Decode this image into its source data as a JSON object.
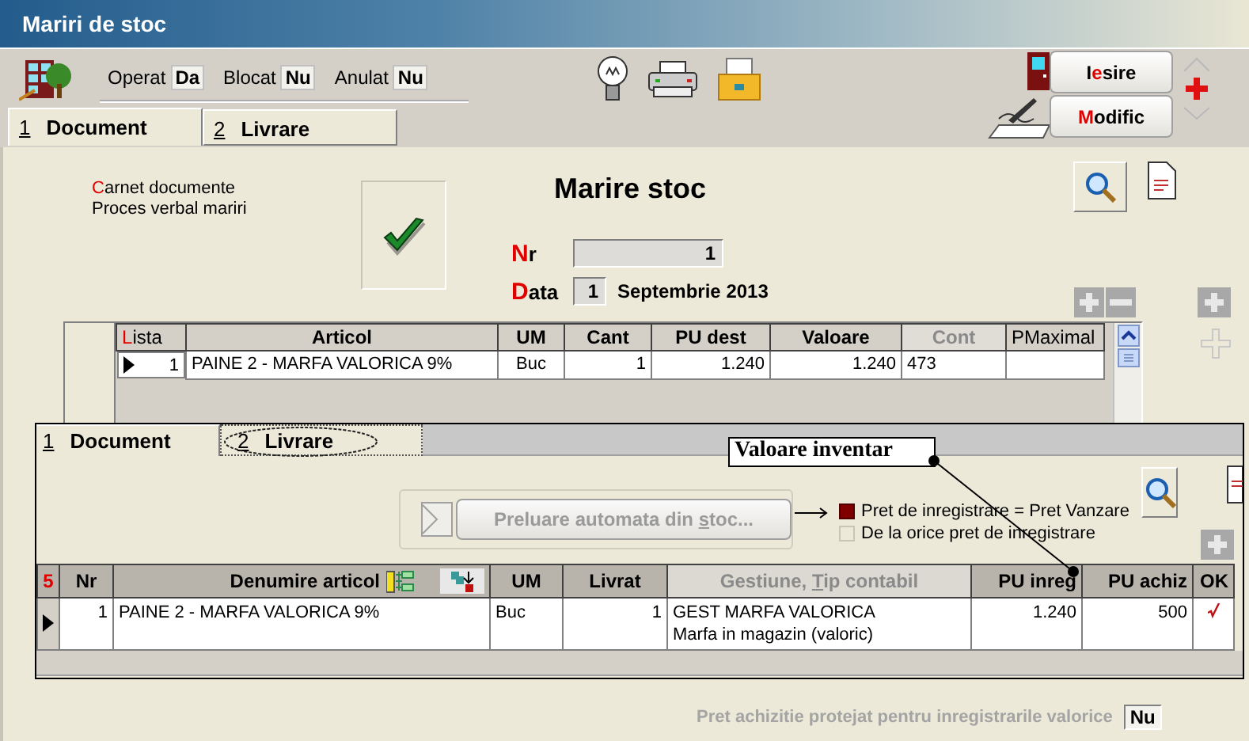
{
  "window": {
    "title": "Mariri de stoc"
  },
  "status_flags": [
    {
      "label": "Operat",
      "value": "Da"
    },
    {
      "label": "Blocat",
      "value": "Nu"
    },
    {
      "label": "Anulat",
      "value": "Nu"
    }
  ],
  "actions": [
    {
      "before": "I",
      "hotkey": "e",
      "after": "sire"
    },
    {
      "hotkey": "M",
      "after": "odific"
    }
  ],
  "tabs": [
    {
      "number": "1",
      "label": "Document",
      "selected": true
    },
    {
      "number": "2",
      "label": "Livrare",
      "selected": false
    }
  ],
  "document": {
    "book_lines": [
      {
        "hotkey": "C",
        "after": "arnet documente"
      },
      {
        "before": "Proces verbal mariri"
      }
    ],
    "confirmed": true,
    "title": "Marire stoc",
    "nr": {
      "label": {
        "hotkey": "N",
        "after": "r"
      },
      "value": "1"
    },
    "date": {
      "label": {
        "hotkey": "D",
        "after": "ata"
      },
      "day": "1",
      "month_year": "Septembrie 2013"
    }
  },
  "articles_table": {
    "columns": [
      {
        "label": {
          "hotkey": "L",
          "after": "ista"
        },
        "disabled": false
      },
      {
        "label": {
          "before": "Articol"
        },
        "disabled": false
      },
      {
        "label": {
          "before": "UM"
        },
        "disabled": false
      },
      {
        "label": {
          "before": "Cant"
        },
        "disabled": false
      },
      {
        "label": {
          "before": "PU dest"
        },
        "disabled": false
      },
      {
        "label": {
          "before": "Valoare"
        },
        "disabled": false
      },
      {
        "label": {
          "before": "Cont"
        },
        "disabled": true
      },
      {
        "label": {
          "before": "PMaximal"
        },
        "disabled": false
      }
    ],
    "rows": [
      {
        "current": true,
        "cells": [
          "1",
          "PAINE 2 - MARFA VALORICA 9%",
          "Buc",
          "1",
          "1.240",
          "1.240",
          "473"
        ]
      }
    ]
  },
  "livrare_panel": {
    "tabs": [
      {
        "number": "1",
        "label": "Document",
        "selected": true,
        "circled": false
      },
      {
        "number": "2",
        "label": "Livrare",
        "selected": false,
        "circled": true
      }
    ],
    "fetch_button": {
      "label": {
        "before": "Preluare automata din ",
        "hotkey": "s",
        "after": "toc..."
      },
      "disabled": true
    },
    "price_options": [
      {
        "label": "Pret de inregistrare = Pret Vanzare",
        "selected": true
      },
      {
        "label": "De la orice pret de inregistrare",
        "selected": false
      }
    ],
    "table": {
      "corner": "5",
      "columns": [
        {
          "label": {
            "before": "Nr"
          },
          "disabled": false
        },
        {
          "label": {
            "before": "Denumire articol"
          },
          "disabled": false
        },
        {
          "label": {
            "before": "UM"
          },
          "disabled": false
        },
        {
          "label": {
            "before": "Livrat"
          },
          "disabled": false
        },
        {
          "label": {
            "before": "Gestiune, ",
            "hotkey": "T",
            "after": "ip contabil"
          },
          "disabled": true
        },
        {
          "label": {
            "before": "PU inreg"
          },
          "disabled": false
        },
        {
          "label": {
            "before": "PU achiz"
          },
          "disabled": false
        },
        {
          "label": {
            "before": "OK"
          },
          "disabled": false
        }
      ],
      "rows": [
        {
          "current": true,
          "nr": "1",
          "article": "PAINE 2 - MARFA VALORICA 9%",
          "um": "Buc",
          "delivered": "1",
          "warehouse": "GEST MARFA VALORICA",
          "account_type": "Marfa in magazin (valoric)",
          "pu_inreg": "1.240",
          "pu_achiz": "500",
          "ok": true
        }
      ]
    }
  },
  "protected_price": {
    "label": "Pret achizitie protejat pentru inregistrarile valorice",
    "value": "Nu"
  },
  "callout": {
    "text": "Valoare inventar"
  }
}
